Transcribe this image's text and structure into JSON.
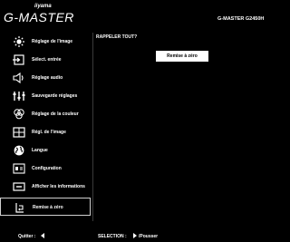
{
  "brand": {
    "logo_top": "iiyama",
    "logo_main": "G-MASTER"
  },
  "header": {
    "model": "G-MASTER G2450H"
  },
  "menu": {
    "items": [
      {
        "label": "Réglage de l'image",
        "icon": "picture-adjust-icon"
      },
      {
        "label": "Sélect. entrée",
        "icon": "input-select-icon"
      },
      {
        "label": "Réglage audio",
        "icon": "audio-icon"
      },
      {
        "label": "Sauvegarde réglages",
        "icon": "save-settings-icon"
      },
      {
        "label": "Réglage de la couleur",
        "icon": "color-adjust-icon"
      },
      {
        "label": "Régl. de l'image",
        "icon": "image-adjust-icon"
      },
      {
        "label": "Langue",
        "icon": "language-globe-icon"
      },
      {
        "label": "Configuration",
        "icon": "configuration-icon"
      },
      {
        "label": "Afficher les informations",
        "icon": "information-icon"
      },
      {
        "label": "Remise à zéro",
        "icon": "reset-icon"
      }
    ],
    "selected_index": 9
  },
  "panel": {
    "title": "RAPPELER TOUT?",
    "button_label": "Remise à zéro"
  },
  "footer": {
    "quit_label": "Quitter :",
    "select_label": "SELECTION :",
    "push_label": "/Pousser"
  }
}
